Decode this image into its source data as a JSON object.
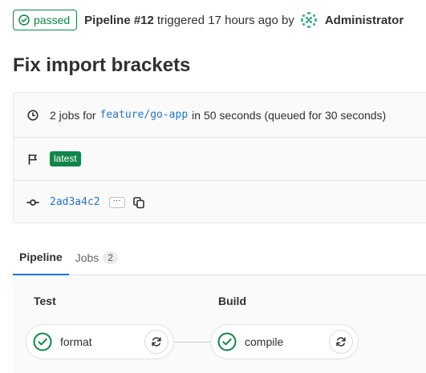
{
  "header": {
    "status_label": "passed",
    "pipeline_title": "Pipeline #12",
    "triggered_text": "triggered 17 hours ago by",
    "user_name": "Administrator"
  },
  "commit": {
    "title": "Fix import brackets"
  },
  "info": {
    "jobs_prefix": "2 jobs for",
    "branch": "feature/go-app",
    "duration_text": "in 50 seconds (queued for 30 seconds)",
    "latest_badge": "latest",
    "sha": "2ad3a4c2",
    "ellipsis": "···"
  },
  "tabs": [
    {
      "label": "Pipeline",
      "active": true
    },
    {
      "label": "Jobs",
      "count": "2",
      "active": false
    }
  ],
  "stages": [
    {
      "title": "Test",
      "jobs": [
        {
          "name": "format",
          "status": "success"
        }
      ]
    },
    {
      "title": "Build",
      "jobs": [
        {
          "name": "compile",
          "status": "success"
        }
      ]
    }
  ],
  "colors": {
    "success": "#108548",
    "link": "#1f75cb",
    "accent_tab": "#1f75cb"
  },
  "icons": {
    "status": "check-circle-icon",
    "clock": "clock-icon",
    "flag": "flag-icon",
    "commit": "commit-icon",
    "copy": "copy-icon",
    "retry": "retry-icon"
  }
}
